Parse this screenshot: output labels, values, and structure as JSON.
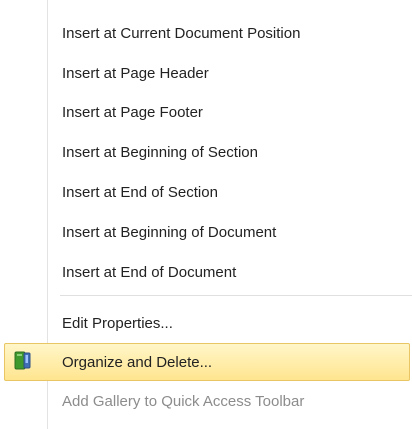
{
  "menu": {
    "items": [
      {
        "label": "Insert at Current Document Position"
      },
      {
        "label": "Insert at Page Header"
      },
      {
        "label": "Insert at Page Footer"
      },
      {
        "label": "Insert at Beginning of Section"
      },
      {
        "label": "Insert at End of Section"
      },
      {
        "label": "Insert at Beginning of Document"
      },
      {
        "label": "Insert at End of Document"
      },
      {
        "label": "Edit Properties..."
      },
      {
        "label": "Organize and Delete...",
        "icon": "organizer-book-icon",
        "state": "highlighted"
      },
      {
        "label": "Add Gallery to Quick Access Toolbar",
        "state": "disabled"
      }
    ]
  },
  "colors": {
    "highlight_background": "#ffe58f",
    "highlight_border": "#e9c663",
    "text": "#222222",
    "disabled_text": "#8c8c8c",
    "icon_green": "#3f9a2d",
    "icon_blue": "#3f6fb4"
  }
}
